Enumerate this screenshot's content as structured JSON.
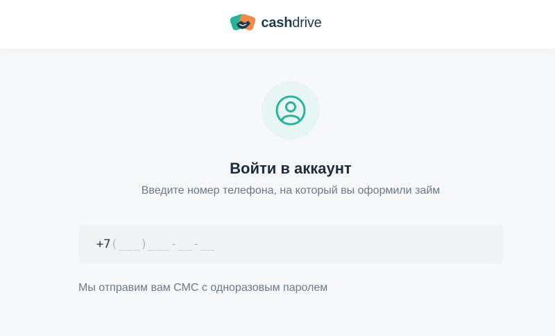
{
  "brand": {
    "name_bold": "cash",
    "name_regular": "drive",
    "logo_icon": "handshake-logo-icon",
    "colors": {
      "teal": "#2bb39a",
      "orange": "#f08a4b",
      "dark": "#1f3a4d"
    }
  },
  "login": {
    "avatar_icon": "user-circle-icon",
    "title": "Войти в аккаунт",
    "subtitle": "Введите номер телефона, на который вы оформили займ",
    "phone": {
      "prefix": "+7",
      "mask": "(___)___-__-__"
    },
    "hint": "Мы отправим вам СМС с одноразовым паролем"
  }
}
